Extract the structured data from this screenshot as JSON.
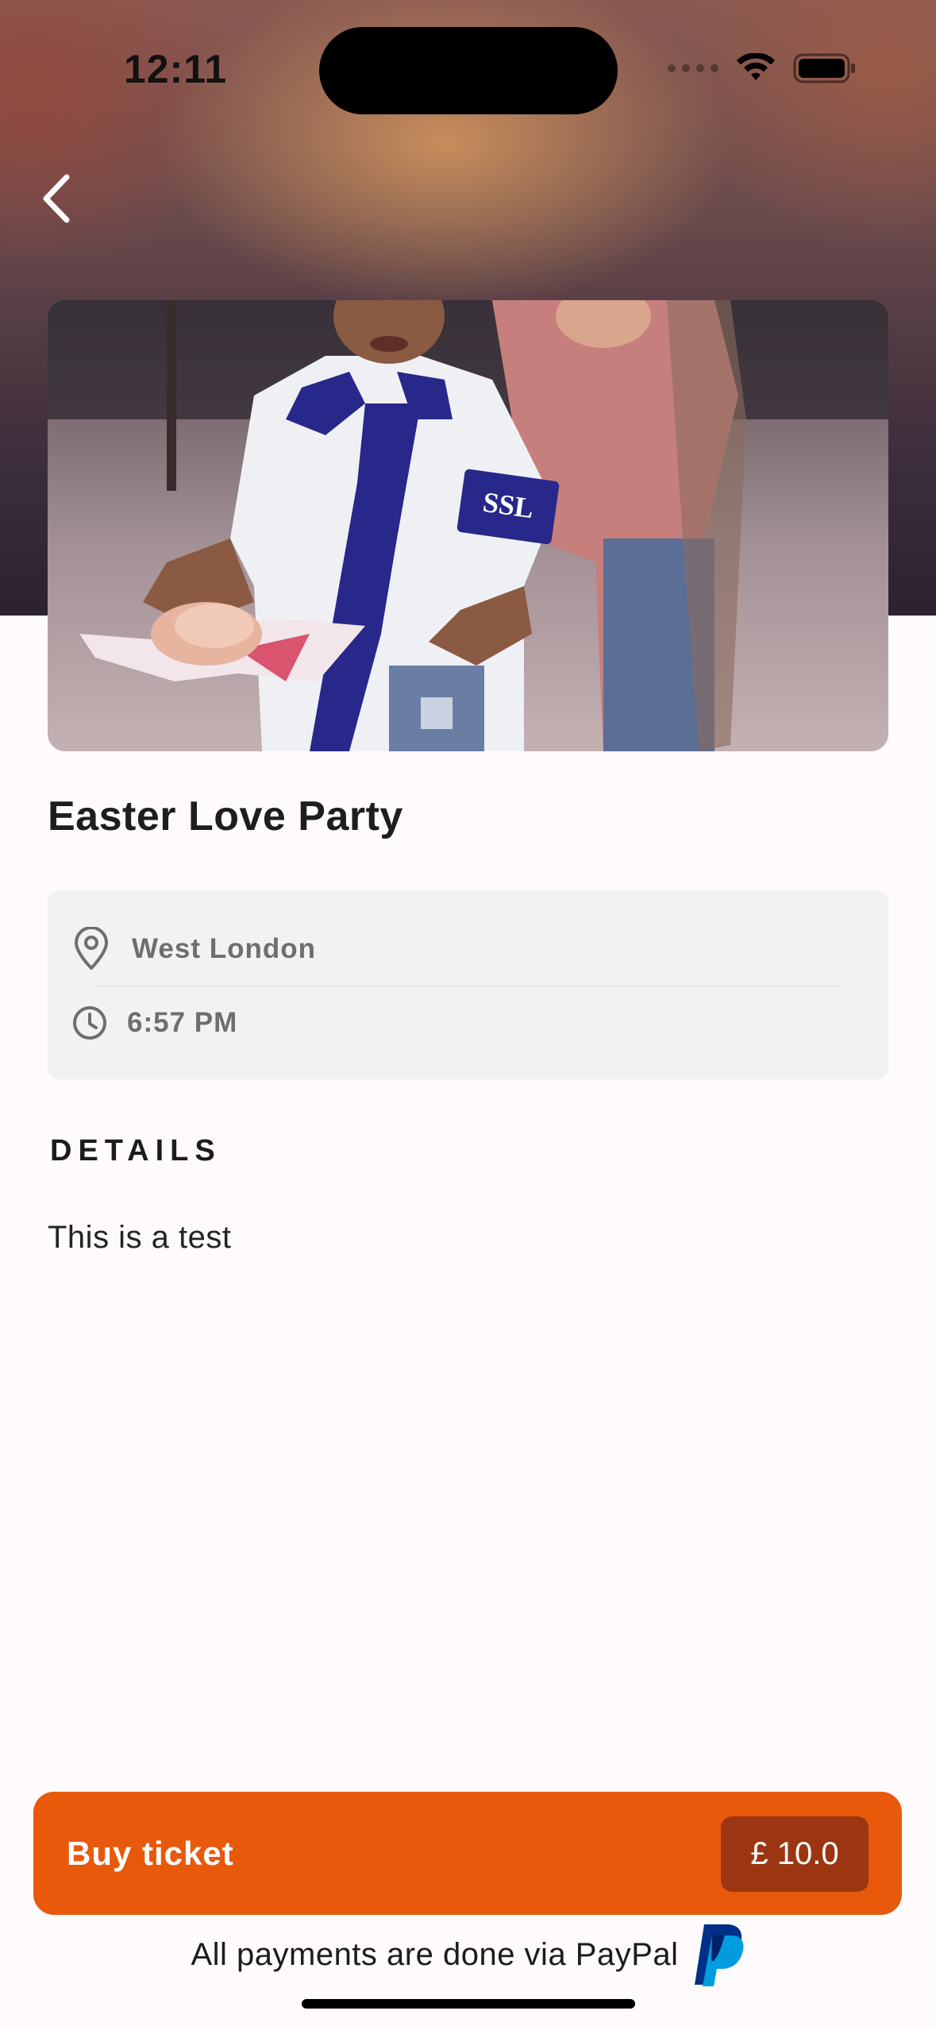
{
  "status_bar": {
    "time": "12:11"
  },
  "event": {
    "title": "Easter Love Party",
    "photo_text": "SSL",
    "location": "West London",
    "time": "6:57 PM"
  },
  "details": {
    "heading": "DETAILS",
    "body": "This is a test"
  },
  "purchase": {
    "button_label": "Buy ticket",
    "price": "£ 10.0",
    "note": "All payments are done via PayPal"
  },
  "colors": {
    "accent": "#e8590c",
    "price_badge": "#9c3612",
    "info_box": "#f1f3f3",
    "paypal_dark": "#003087",
    "paypal_light": "#009cde"
  },
  "icons": {
    "back": "chevron-left-icon",
    "location": "location-pin-icon",
    "clock": "clock-icon",
    "paypal": "paypal-logo"
  }
}
